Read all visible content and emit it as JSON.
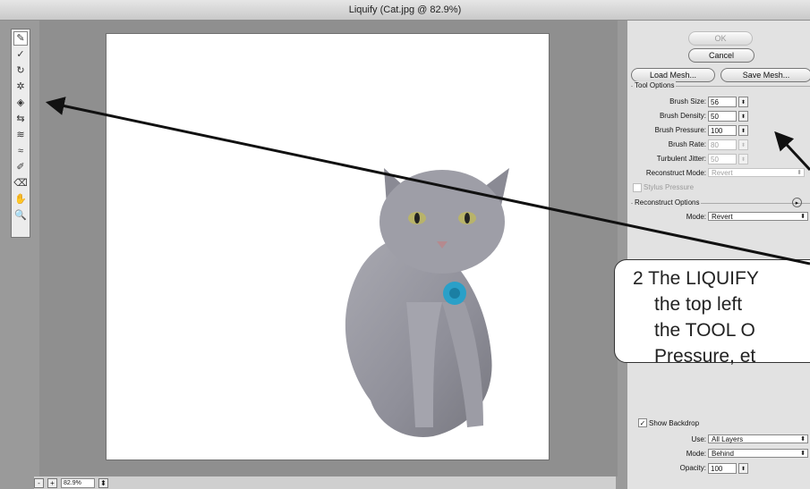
{
  "window": {
    "title": "Liquify (Cat.jpg @ 82.9%)"
  },
  "tools": [
    {
      "icon": "forward-warp-icon",
      "glyph": "✎"
    },
    {
      "icon": "reconstruct-icon",
      "glyph": "✓"
    },
    {
      "icon": "twirl-icon",
      "glyph": "↻"
    },
    {
      "icon": "pucker-icon",
      "glyph": "✲"
    },
    {
      "icon": "bloat-icon",
      "glyph": "◈"
    },
    {
      "icon": "push-left-icon",
      "glyph": "⇆"
    },
    {
      "icon": "mirror-icon",
      "glyph": "≋"
    },
    {
      "icon": "turbulence-icon",
      "glyph": "≈"
    },
    {
      "icon": "freeze-mask-icon",
      "glyph": "✐"
    },
    {
      "icon": "thaw-mask-icon",
      "glyph": "⌫"
    },
    {
      "icon": "hand-icon",
      "glyph": "✋"
    },
    {
      "icon": "zoom-icon",
      "glyph": "🔍"
    }
  ],
  "status": {
    "minus": "-",
    "plus": "+",
    "zoom": "82.9%",
    "zoom_arrow": "⬍"
  },
  "panel": {
    "ok_label": "OK",
    "cancel_label": "Cancel",
    "load_mesh_label": "Load Mesh...",
    "save_mesh_label": "Save Mesh...",
    "tool_options_title": "Tool Options",
    "brush_size": {
      "label": "Brush Size:",
      "value": "56"
    },
    "brush_density": {
      "label": "Brush Density:",
      "value": "50"
    },
    "brush_pressure": {
      "label": "Brush Pressure:",
      "value": "100"
    },
    "brush_rate": {
      "label": "Brush Rate:",
      "value": "80"
    },
    "turbulent_jitter": {
      "label": "Turbulent Jitter:",
      "value": "50"
    },
    "reconstruct_mode": {
      "label": "Reconstruct Mode:",
      "value": "Revert"
    },
    "stylus_pressure_label": "Stylus Pressure",
    "reconstruct_options_title": "Reconstruct Options",
    "reconstruct_options_mode": {
      "label": "Mode:",
      "value": "Revert"
    },
    "show_backdrop_label": "Show Backdrop",
    "use": {
      "label": "Use:",
      "value": "All Layers"
    },
    "backdrop_mode": {
      "label": "Mode:",
      "value": "Behind"
    },
    "opacity": {
      "label": "Opacity:",
      "value": "100"
    },
    "stepper_glyph": "⬍",
    "select_arrow": "⬍"
  },
  "callout": {
    "line1": "2 The LIQUIFY",
    "line2": "the top left",
    "line3": "the TOOL O",
    "line4": "Pressure, et"
  },
  "colors": {
    "callout_arrow": "#111111",
    "canvas": "#8f8f8f",
    "panel": "#e2e2e2"
  }
}
